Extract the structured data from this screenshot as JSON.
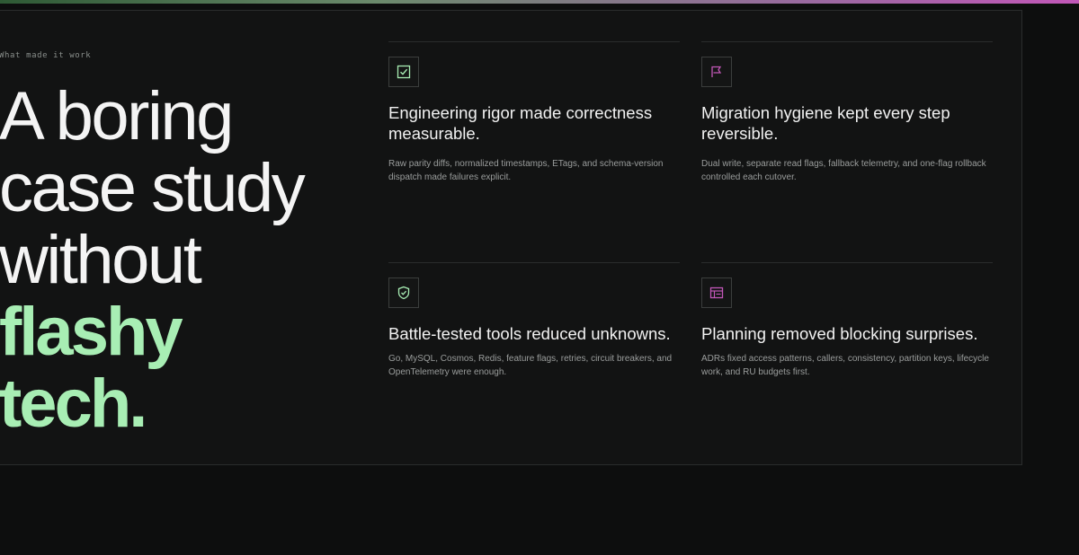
{
  "eyebrow": "What made it work",
  "headline": {
    "line1": "A boring",
    "line2": "case study",
    "line3": "without",
    "accent1": "flashy",
    "accent2": "tech."
  },
  "colors": {
    "accent_green": "#a8eeb4",
    "accent_pink": "#c257b8",
    "background": "#0d0e0e"
  },
  "cards": [
    {
      "icon": "checkbox-icon",
      "title": "Engineering rigor made correctness measurable.",
      "body": "Raw parity diffs, normalized timestamps, ETags, and schema-version dispatch made failures explicit."
    },
    {
      "icon": "flag-icon",
      "title": "Migration hygiene kept every step reversible.",
      "body": "Dual write, separate read flags, fallback telemetry, and one-flag rollback controlled each cutover."
    },
    {
      "icon": "shield-check-icon",
      "title": "Battle-tested tools reduced unknowns.",
      "body": "Go, MySQL, Cosmos, Redis, feature flags, retries, circuit breakers, and OpenTelemetry were enough."
    },
    {
      "icon": "table-icon",
      "title": "Planning removed blocking surprises.",
      "body": "ADRs fixed access patterns, callers, consistency, partition keys, lifecycle work, and RU budgets first."
    }
  ]
}
